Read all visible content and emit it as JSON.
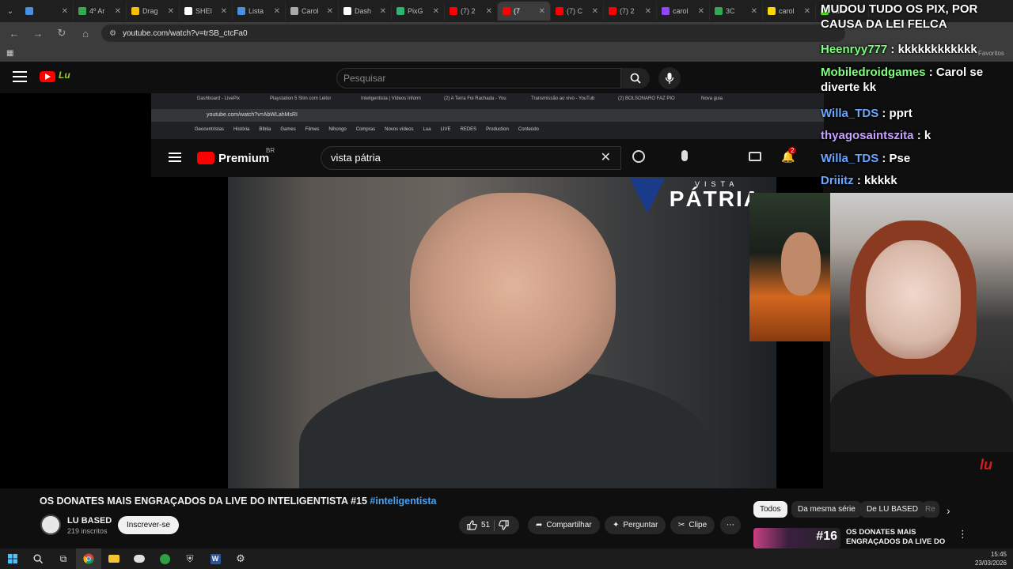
{
  "browser": {
    "tabs": [
      {
        "label": "",
        "color": "#4a90e2"
      },
      {
        "label": "4º Ar",
        "color": "#34a853"
      },
      {
        "label": "Drag",
        "color": "#fbbc05"
      },
      {
        "label": "SHEI",
        "color": "#ffffff"
      },
      {
        "label": "Lista",
        "color": "#4a90e2"
      },
      {
        "label": "Carol",
        "color": "#aaaaaa"
      },
      {
        "label": "Dash",
        "color": "#ffffff"
      },
      {
        "label": "PixG",
        "color": "#2bb673"
      },
      {
        "label": "(7) 2",
        "color": "#ff0000"
      },
      {
        "label": "(7",
        "color": "#ff0000"
      },
      {
        "label": "(7) C",
        "color": "#ff0000"
      },
      {
        "label": "(7) 2",
        "color": "#ff0000"
      },
      {
        "label": "carol",
        "color": "#9146ff"
      },
      {
        "label": "3C",
        "color": "#34a853"
      },
      {
        "label": "carol",
        "color": "#ffd700"
      },
      {
        "label": "caro",
        "color": "#53fc18"
      }
    ],
    "url": "youtube.com/watch?v=trSB_ctcFa0",
    "bookmarks_label": "Favoritos"
  },
  "youtube": {
    "search_placeholder": "Pesquisar",
    "brand_text": "Lu"
  },
  "inner_browser": {
    "tabs": [
      "Dashboard - LivePix",
      "Playstation 5 Slim com Leitor",
      "Inteligentista | Vídeos Inform",
      "(2) A Terra Foi Rachada - You",
      "Transmissão ao vivo - YouTub",
      "(2) BOLSONARO FAZ PIO",
      "Nova guia"
    ],
    "url": "youtube.com/watch?v=AbWLahMsRI",
    "bookmarks": [
      "Geocentristas",
      "História",
      "Bíblia",
      "Games",
      "Filmes",
      "Nihongo",
      "Compras",
      "Novos vídeos",
      "Lua",
      "LIVE",
      "REDES",
      "Production",
      "Conteúdo"
    ],
    "premium": "Premium",
    "premium_region": "BR",
    "search_value": "vista pátria",
    "notif_count": "2",
    "watermark_small": "VISTA",
    "watermark_big": "PÁTRIA"
  },
  "chat": [
    {
      "user": "",
      "text": "MUDOU TUDO OS PIX, POR CAUSA DA LEI FELCA"
    },
    {
      "user": "Heenryy777",
      "text": ": kkkkkkkkkkkk"
    },
    {
      "user": "Mobiledroidgames",
      "text": ": Carol se diverte kk"
    },
    {
      "user": "Willa_TDS",
      "text": ": pprt"
    },
    {
      "user": "thyagosaintszita",
      "text": ": k"
    },
    {
      "user": "Willa_TDS",
      "text": ": Pse"
    },
    {
      "user": "Driiitz",
      "text": ": kkkkk"
    }
  ],
  "video": {
    "title": "OS DONATES MAIS ENGRAÇADOS DA LIVE DO INTELIGENTISTA #15",
    "hashtag": "#inteligentista",
    "channel": "LU BASED",
    "subscribers": "219 inscritos",
    "subscribe_label": "Inscrever-se",
    "likes": "51",
    "share_label": "Compartilhar",
    "ask_label": "Perguntar",
    "clip_label": "Clipe"
  },
  "chips": [
    "Todos",
    "Da mesma série",
    "De LU BASED",
    "Re"
  ],
  "recommended": {
    "number": "#16",
    "title": "OS DONATES MAIS ENGRAÇADOS DA LIVE DO ..."
  },
  "taskbar": {
    "time": "15:45",
    "date": "23/03/2026"
  },
  "colors": {
    "accent": "#3ea6ff",
    "yt_red": "#ff0000",
    "chat_green": "#7fff7f",
    "chat_purple": "#c8a2ff",
    "chat_blue": "#6aa8ff"
  }
}
